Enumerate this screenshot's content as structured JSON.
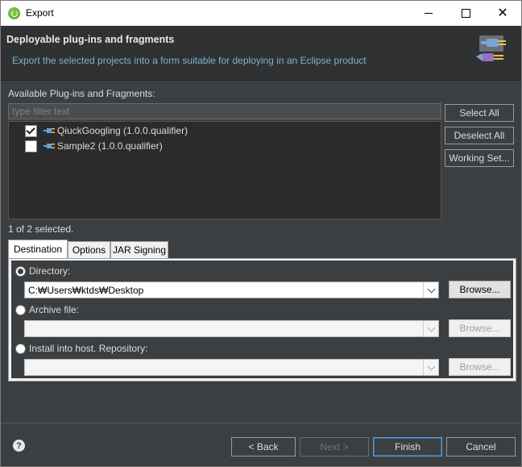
{
  "window": {
    "title": "Export"
  },
  "banner": {
    "heading": "Deployable plug-ins and fragments",
    "description": "Export the selected projects into a form suitable for deploying in an Eclipse product"
  },
  "available": {
    "label": "Available Plug-ins and Fragments:",
    "filter_placeholder": "type filter text",
    "items": [
      {
        "label": "QiuckGoogling (1.0.0.qualifier)",
        "checked": true
      },
      {
        "label": "Sample2 (1.0.0.qualifier)",
        "checked": false
      }
    ],
    "status": "1 of 2 selected."
  },
  "side_buttons": {
    "select_all": "Select All",
    "deselect_all": "Deselect All",
    "working_set": "Working Set..."
  },
  "tabs": [
    "Destination",
    "Options",
    "JAR Signing"
  ],
  "destination": {
    "directory_label": "Directory:",
    "directory_value": "C:₩Users₩ktds₩Desktop",
    "archive_label": "Archive file:",
    "archive_value": "",
    "install_label": "Install into host. Repository:",
    "install_value": "",
    "browse": "Browse...",
    "selected_option": "Directory"
  },
  "footer": {
    "back": "< Back",
    "next": "Next >",
    "finish": "Finish",
    "cancel": "Cancel"
  }
}
